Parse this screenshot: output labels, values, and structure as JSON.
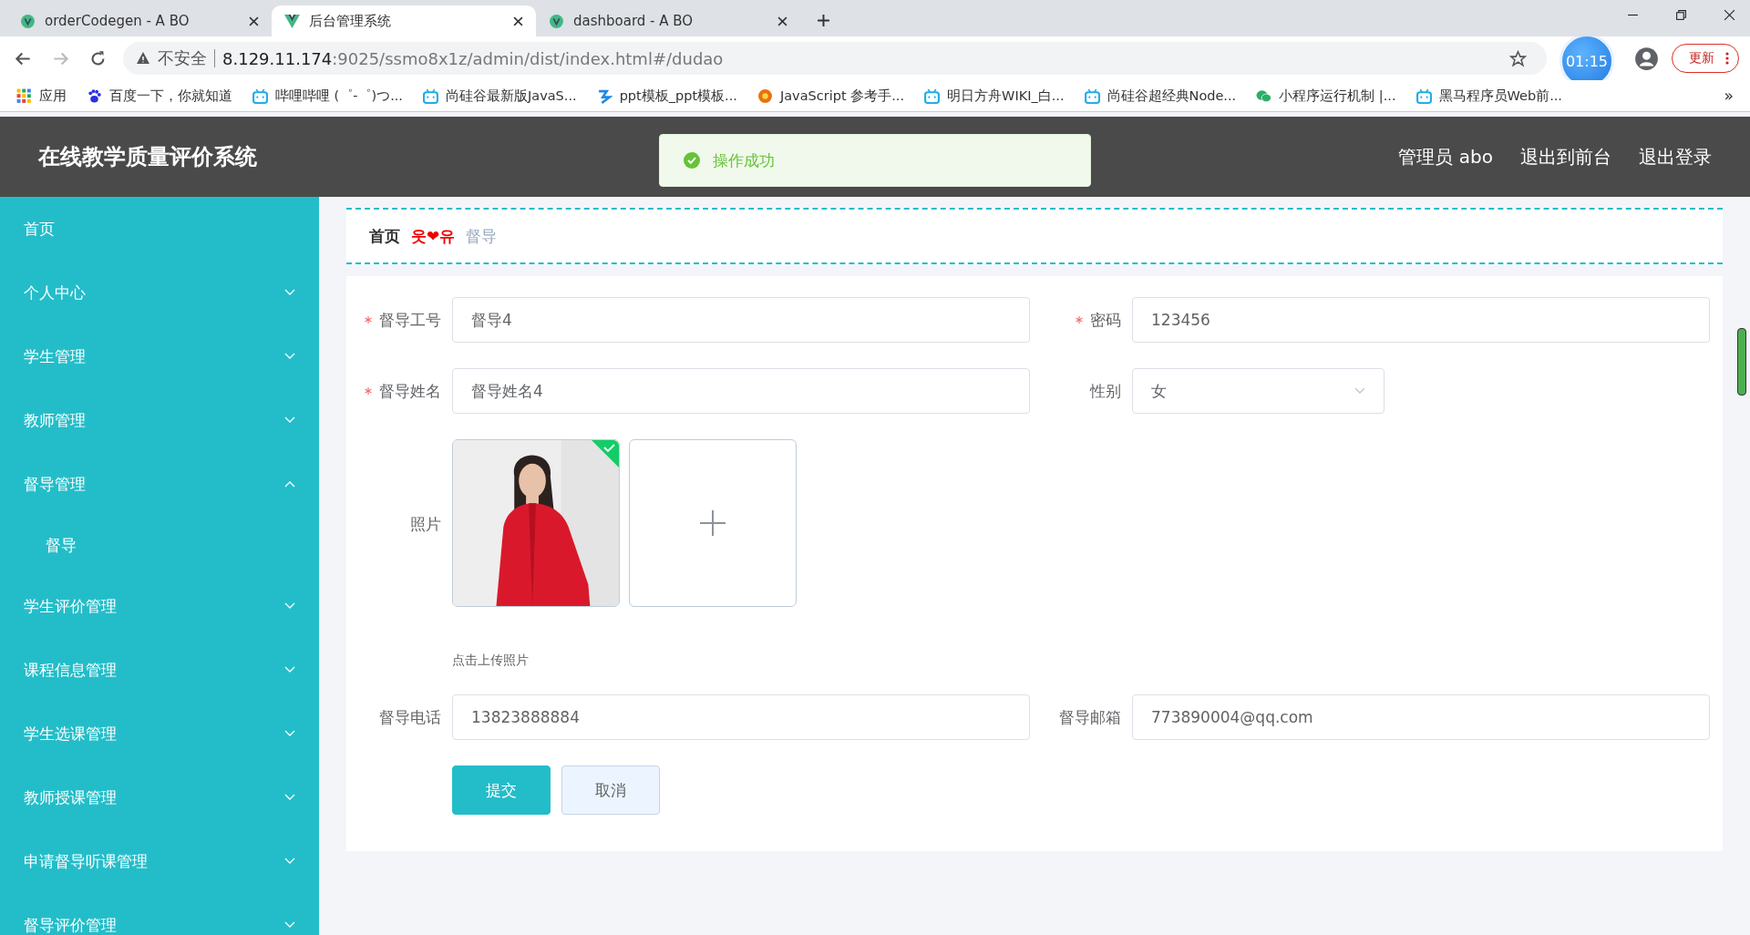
{
  "browser": {
    "tabs": [
      {
        "title": "orderCodegen - A BO",
        "selected": false,
        "kind": "circle"
      },
      {
        "title": "后台管理系统",
        "selected": true,
        "kind": "vue"
      },
      {
        "title": "dashboard - A BO",
        "selected": false,
        "kind": "circle"
      }
    ],
    "security": "不安全",
    "url_host": "8.129.11.174",
    "url_rest": ":9025/ssmo8x1z/admin/dist/index.html#/dudao",
    "timer": "01:15",
    "update": "更新",
    "bookmarks": [
      {
        "label": "应用",
        "kind": "apps"
      },
      {
        "label": "百度一下，你就知道",
        "kind": "paw"
      },
      {
        "label": "哔哩哔哩 (゜-゜)つ...",
        "kind": "tv"
      },
      {
        "label": "尚硅谷最新版JavaS...",
        "kind": "tv"
      },
      {
        "label": "ppt模板_ppt模板...",
        "kind": "wave"
      },
      {
        "label": "JavaScript 参考手...",
        "kind": "flower"
      },
      {
        "label": "明日方舟WIKI_白...",
        "kind": "tv"
      },
      {
        "label": "尚硅谷超经典Node...",
        "kind": "tv"
      },
      {
        "label": "小程序运行机制 |...",
        "kind": "chat"
      },
      {
        "label": "黑马程序员Web前...",
        "kind": "tv"
      }
    ],
    "more": "»"
  },
  "header": {
    "title": "在线教学质量评价系统",
    "toast": "操作成功",
    "nav": [
      "管理员 abo",
      "退出到前台",
      "退出登录"
    ]
  },
  "sidebar": {
    "items": [
      {
        "label": "首页",
        "kind": "link"
      },
      {
        "label": "个人中心",
        "kind": "group",
        "expanded": false
      },
      {
        "label": "学生管理",
        "kind": "group",
        "expanded": false
      },
      {
        "label": "教师管理",
        "kind": "group",
        "expanded": false
      },
      {
        "label": "督导管理",
        "kind": "group",
        "expanded": true,
        "children": [
          {
            "label": "督导"
          }
        ]
      },
      {
        "label": "学生评价管理",
        "kind": "group",
        "expanded": false
      },
      {
        "label": "课程信息管理",
        "kind": "group",
        "expanded": false
      },
      {
        "label": "学生选课管理",
        "kind": "group",
        "expanded": false
      },
      {
        "label": "教师授课管理",
        "kind": "group",
        "expanded": false
      },
      {
        "label": "申请督导听课管理",
        "kind": "group",
        "expanded": false
      },
      {
        "label": "督导评价管理",
        "kind": "group",
        "expanded": false
      }
    ]
  },
  "breadcrumb": {
    "items": [
      "首页",
      "督导"
    ],
    "separator": "웃❤유"
  },
  "form": {
    "fields": [
      {
        "label": "督导工号",
        "kind": "input",
        "required": true,
        "value": "督导4"
      },
      {
        "label": "密码",
        "kind": "input",
        "required": true,
        "value": "123456"
      },
      {
        "label": "督导姓名",
        "kind": "input",
        "required": true,
        "value": "督导姓名4"
      },
      {
        "label": "性别",
        "kind": "select",
        "required": false,
        "value": "女"
      },
      {
        "label": "照片",
        "kind": "upload",
        "required": false,
        "uploaded": true,
        "hint": "点击上传照片"
      },
      {
        "label": "督导电话",
        "kind": "input",
        "required": false,
        "value": "13823888884"
      },
      {
        "label": "督导邮箱",
        "kind": "input",
        "required": false,
        "value": "773890004@qq.com"
      }
    ],
    "buttons": [
      {
        "label": "提交",
        "kind": "primary"
      },
      {
        "label": "取消",
        "kind": "default"
      }
    ]
  }
}
